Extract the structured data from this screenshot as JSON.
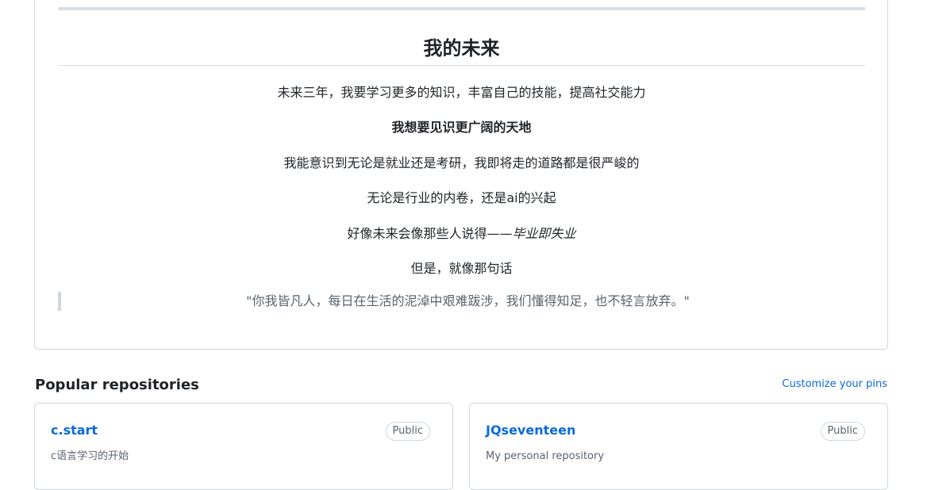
{
  "readme": {
    "title": "我的未来",
    "paragraphs": [
      "未来三年，我要学习更多的知识，丰富自己的技能，提高社交能力",
      "我想要见识更广阔的天地",
      "我能意识到无论是就业还是考研，我即将走的道路都是很严峻的",
      "无论是行业的内卷，还是ai的兴起",
      "好像未来会像那些人说得——",
      "但是，就像那句话"
    ],
    "emphasis": "毕业即失业",
    "quote": "\"你我皆凡人，每日在生活的泥淖中艰难跋涉，我们懂得知足，也不轻言放弃。\""
  },
  "popular": {
    "title": "Popular repositories",
    "customize_label": "Customize your pins",
    "repos": [
      {
        "name": "c.start",
        "visibility": "Public",
        "description": "c语言学习的开始"
      },
      {
        "name": "JQseventeen",
        "visibility": "Public",
        "description": "My personal repository"
      }
    ]
  }
}
